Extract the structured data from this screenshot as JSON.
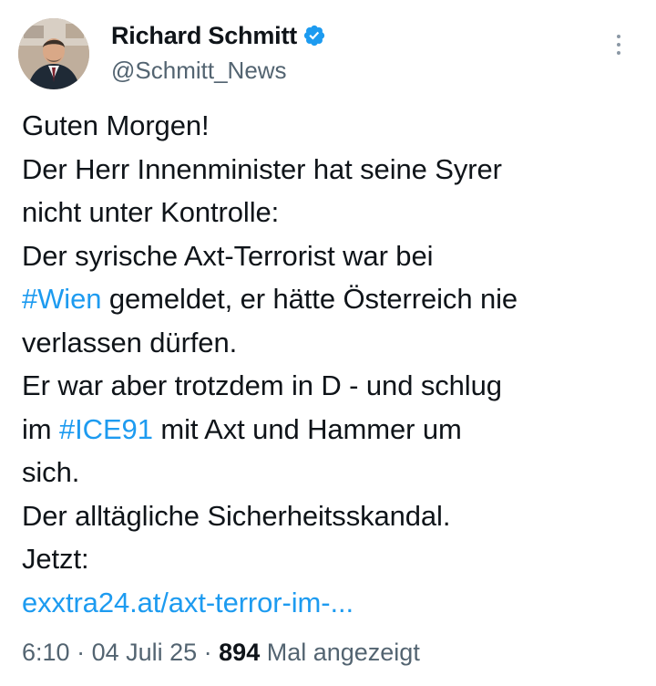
{
  "author": {
    "name": "Richard Schmitt",
    "handle": "@Schmitt_News",
    "verified_color": "#1d9bf0"
  },
  "tweet": {
    "lines": [
      [
        {
          "text": "Guten Morgen!"
        }
      ],
      [
        {
          "text": "Der Herr Innenminister hat seine Syrer"
        }
      ],
      [
        {
          "text": "nicht unter Kontrolle:"
        }
      ],
      [
        {
          "text": "Der syrische Axt-Terrorist war bei"
        }
      ],
      [
        {
          "text": "#Wien",
          "link": true
        },
        {
          "text": " gemeldet, er hätte Österreich nie"
        }
      ],
      [
        {
          "text": "verlassen dürfen."
        }
      ],
      [
        {
          "text": "Er war aber trotzdem in D - und schlug"
        }
      ],
      [
        {
          "text": "im "
        },
        {
          "text": "#ICE91",
          "link": true
        },
        {
          "text": " mit Axt und Hammer um"
        }
      ],
      [
        {
          "text": "sich."
        }
      ],
      [
        {
          "text": "Der alltägliche Sicherheitsskandal."
        }
      ],
      [
        {
          "text": "Jetzt:"
        }
      ],
      [
        {
          "text": "exxtra24.at/axt-terror-im-...",
          "link": true
        }
      ]
    ]
  },
  "meta": {
    "time": "6:10",
    "separator": " · ",
    "date": "04 Juli 25",
    "views_count": "894",
    "views_label": " Mal angezeigt"
  },
  "colors": {
    "link": "#1d9bf0",
    "secondary_text": "#536471",
    "primary_text": "#0f1419"
  },
  "icons": {
    "verified": "verified-badge-icon",
    "more": "more-options-icon"
  }
}
